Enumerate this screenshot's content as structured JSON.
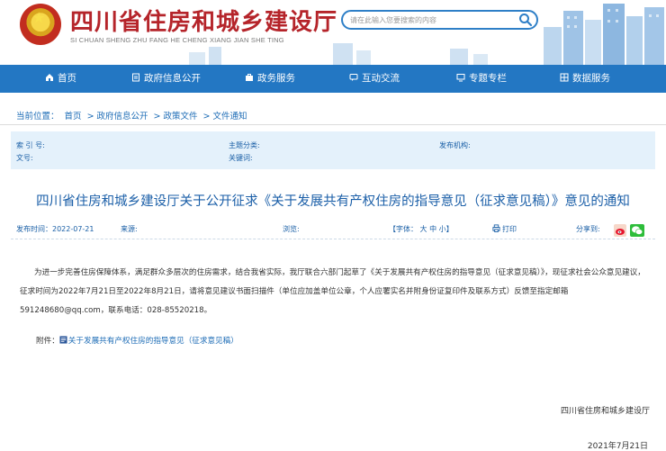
{
  "header": {
    "site_title": "四川省住房和城乡建设厅",
    "site_pinyin": "SI CHUAN SHENG ZHU FANG HE CHENG XIANG JIAN SHE TING",
    "search_placeholder": "请在此输入您要搜索的内容",
    "icons": [
      "national-emblem",
      "search-icon"
    ]
  },
  "nav": {
    "items": [
      {
        "label": "首页",
        "icon": "home-icon"
      },
      {
        "label": "政府信息公开",
        "icon": "document-icon"
      },
      {
        "label": "政务服务",
        "icon": "briefcase-icon"
      },
      {
        "label": "互动交流",
        "icon": "chat-icon"
      },
      {
        "label": "专题专栏",
        "icon": "monitor-icon"
      },
      {
        "label": "数据服务",
        "icon": "grid-icon"
      }
    ]
  },
  "breadcrumb": {
    "prefix": "当前位置：",
    "items": [
      "首页",
      "政府信息公开",
      "政策文件",
      "文件通知"
    ],
    "separator": ">"
  },
  "meta": {
    "index_label": "索 引 号:",
    "topic_label": "主题分类:",
    "publisher_label": "发布机构:",
    "docno_label": "文号:",
    "keywords_label": "关键词:"
  },
  "article": {
    "title": "四川省住房和城乡建设厅关于公开征求《关于发展共有产权住房的指导意见（征求意见稿）》意见的通知",
    "publish_time": "发布时间：2022-07-21",
    "source_label": "来源:",
    "views_label": "浏览:",
    "font_size_control": "【字体： 大 中 小】",
    "print_label": "打印",
    "share_label": "分享到:",
    "body": "为进一步完善住房保障体系，满足群众多层次的住房需求，结合我省实际，我厅联合六部门起草了《关于发展共有产权住房的指导意见（征求意见稿）》，现征求社会公众意见建议，征求时间为2022年7月21日至2022年8月21日，请将意见建议书面扫描件（单位应加盖单位公章，个人应署实名并附身份证复印件及联系方式）反馈至指定邮箱591248680@qq.com，联系电话：028-85520218。",
    "attachment_prefix": "附件：",
    "attachment_link": "关于发展共有产权住房的指导意见（征求意见稿）",
    "signer": "四川省住房和城乡建设厅",
    "sign_date": "2021年7月21日"
  },
  "colors": {
    "nav_bg": "#2377c3",
    "title_red": "#b5242a",
    "link_blue": "#1d6cb6",
    "meta_bg": "#e4f1fb"
  }
}
